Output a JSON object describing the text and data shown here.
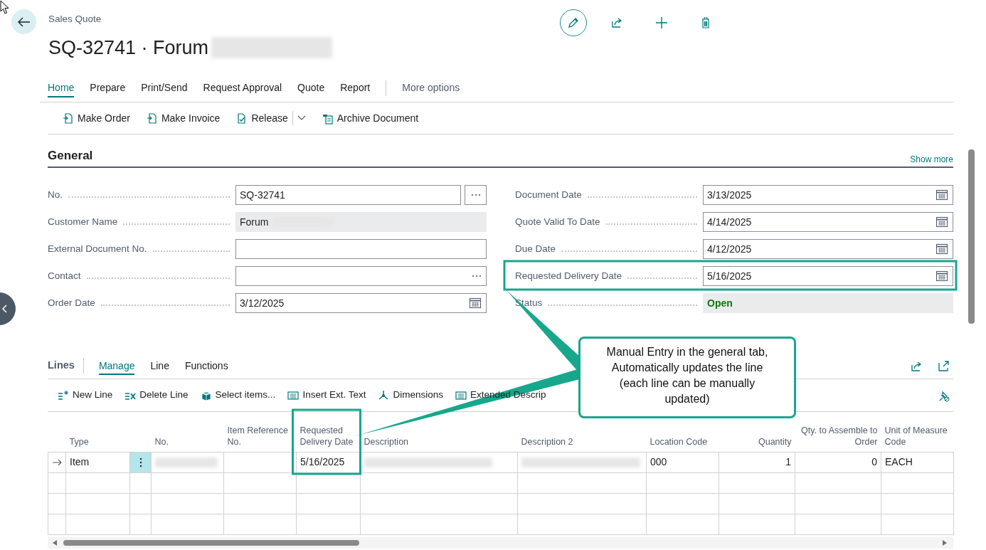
{
  "page": {
    "caption": "Sales Quote",
    "title": "SQ-32741 · Forum",
    "title_redacted": true
  },
  "action_tabs": [
    {
      "label": "Home",
      "selected": true
    },
    {
      "label": "Prepare",
      "selected": false
    },
    {
      "label": "Print/Send",
      "selected": false
    },
    {
      "label": "Request Approval",
      "selected": false
    },
    {
      "label": "Quote",
      "selected": false
    },
    {
      "label": "Report",
      "selected": false
    }
  ],
  "more_options": "More options",
  "actions": [
    {
      "label": "Make Order",
      "has_menu": false
    },
    {
      "label": "Make Invoice",
      "has_menu": false
    },
    {
      "label": "Release",
      "has_menu": true
    },
    {
      "label": "Archive Document",
      "has_menu": false
    }
  ],
  "general": {
    "title": "General",
    "show_more": "Show more",
    "fields_left": [
      {
        "label": "No.",
        "kind": "lookup",
        "value": "SQ-32741"
      },
      {
        "label": "Customer Name",
        "kind": "readonly",
        "value": "Forum",
        "redacted": true
      },
      {
        "label": "External Document No.",
        "kind": "text"
      },
      {
        "label": "Contact",
        "kind": "inline-lookup"
      },
      {
        "label": "Order Date",
        "kind": "date",
        "value": "3/12/2025"
      }
    ],
    "fields_right": [
      {
        "label": "Document Date",
        "kind": "date",
        "value": "3/13/2025"
      },
      {
        "label": "Quote Valid To Date",
        "kind": "date",
        "value": "4/14/2025"
      },
      {
        "label": "Due Date",
        "kind": "date",
        "value": "4/12/2025"
      },
      {
        "label": "Requested Delivery Date",
        "kind": "date",
        "value": "5/16/2025",
        "highlighted": true
      },
      {
        "label": "Status",
        "kind": "status",
        "value": "Open"
      }
    ]
  },
  "lines": {
    "title": "Lines",
    "tabs": [
      {
        "label": "Manage",
        "selected": true
      },
      {
        "label": "Line",
        "selected": false
      },
      {
        "label": "Functions",
        "selected": false
      }
    ],
    "actions": [
      "New Line",
      "Delete Line",
      "Select items...",
      "Insert Ext. Text",
      "Dimensions",
      "Extended Descrip"
    ],
    "columns": [
      {
        "label": "Type",
        "kind": "text"
      },
      {
        "label": "No.",
        "kind": "text"
      },
      {
        "label": "Item Reference No.",
        "kind": "text"
      },
      {
        "label": "Requested Delivery Date",
        "kind": "text",
        "highlighted": true
      },
      {
        "label": "Description",
        "kind": "text"
      },
      {
        "label": "Description 2",
        "kind": "text"
      },
      {
        "label": "Location Code",
        "kind": "text"
      },
      {
        "label": "Quantity",
        "kind": "number"
      },
      {
        "label": "Qty. to Assemble to Order",
        "kind": "number"
      },
      {
        "label": "Unit of Measure Code",
        "kind": "text"
      }
    ],
    "rows": [
      {
        "current": true,
        "cells": [
          "Item",
          {
            "redacted": true
          },
          null,
          "5/16/2025",
          {
            "redacted": true
          },
          {
            "redacted": true
          },
          "000",
          "1",
          "0",
          "EACH"
        ]
      }
    ]
  },
  "annotation": {
    "text": "Manual Entry in the general tab, Automatically updates the line (each line can be manually updated)"
  }
}
